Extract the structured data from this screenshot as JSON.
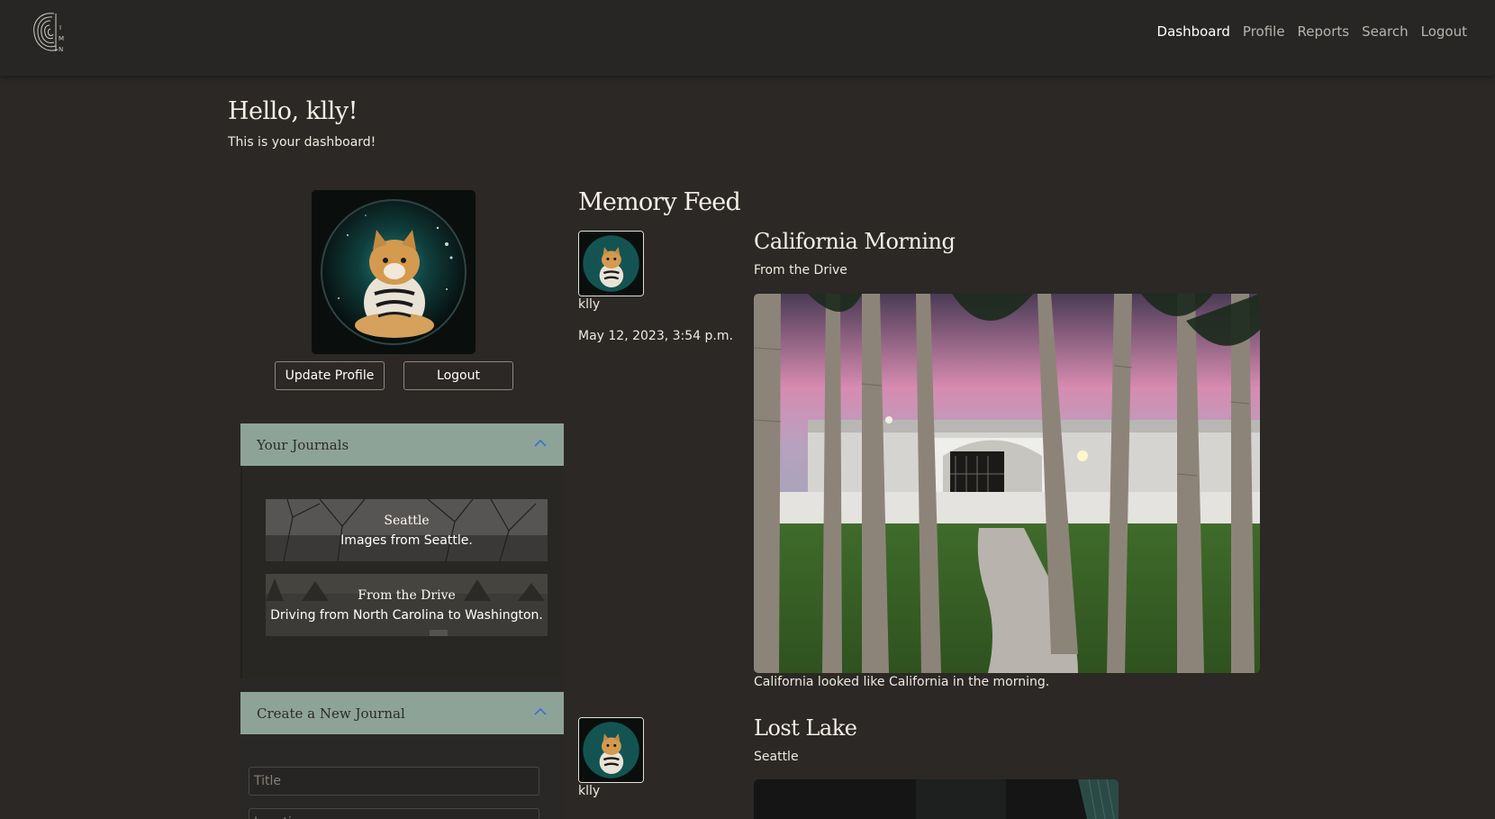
{
  "nav": {
    "logo": "logo",
    "links": [
      "Dashboard",
      "Profile",
      "Reports",
      "Search",
      "Logout"
    ],
    "active": "Dashboard"
  },
  "greeting": {
    "title": "Hello, klly!",
    "subtitle": "This is your dashboard!"
  },
  "profile": {
    "update_label": "Update Profile",
    "logout_label": "Logout"
  },
  "journals_section": {
    "header": "Your Journals",
    "items": [
      {
        "title": "Seattle",
        "description": "Images from Seattle."
      },
      {
        "title": "From the Drive",
        "description": "Driving from North Carolina to Washington."
      }
    ]
  },
  "create_section": {
    "header": "Create a New Journal",
    "title_placeholder": "Title",
    "second_placeholder": "Location"
  },
  "feed": {
    "title": "Memory Feed",
    "posts": [
      {
        "user": "klly",
        "date": "May 12, 2023, 3:54 p.m.",
        "title": "California Morning",
        "journal": "From the Drive",
        "caption": "California looked like California in the morning."
      },
      {
        "user": "klly",
        "title": "Lost Lake",
        "journal": "Seattle"
      }
    ]
  },
  "colors": {
    "background": "#2b2825",
    "navbar": "#272625",
    "accordion_header": "#8ea398",
    "text": "#f1ece4"
  }
}
